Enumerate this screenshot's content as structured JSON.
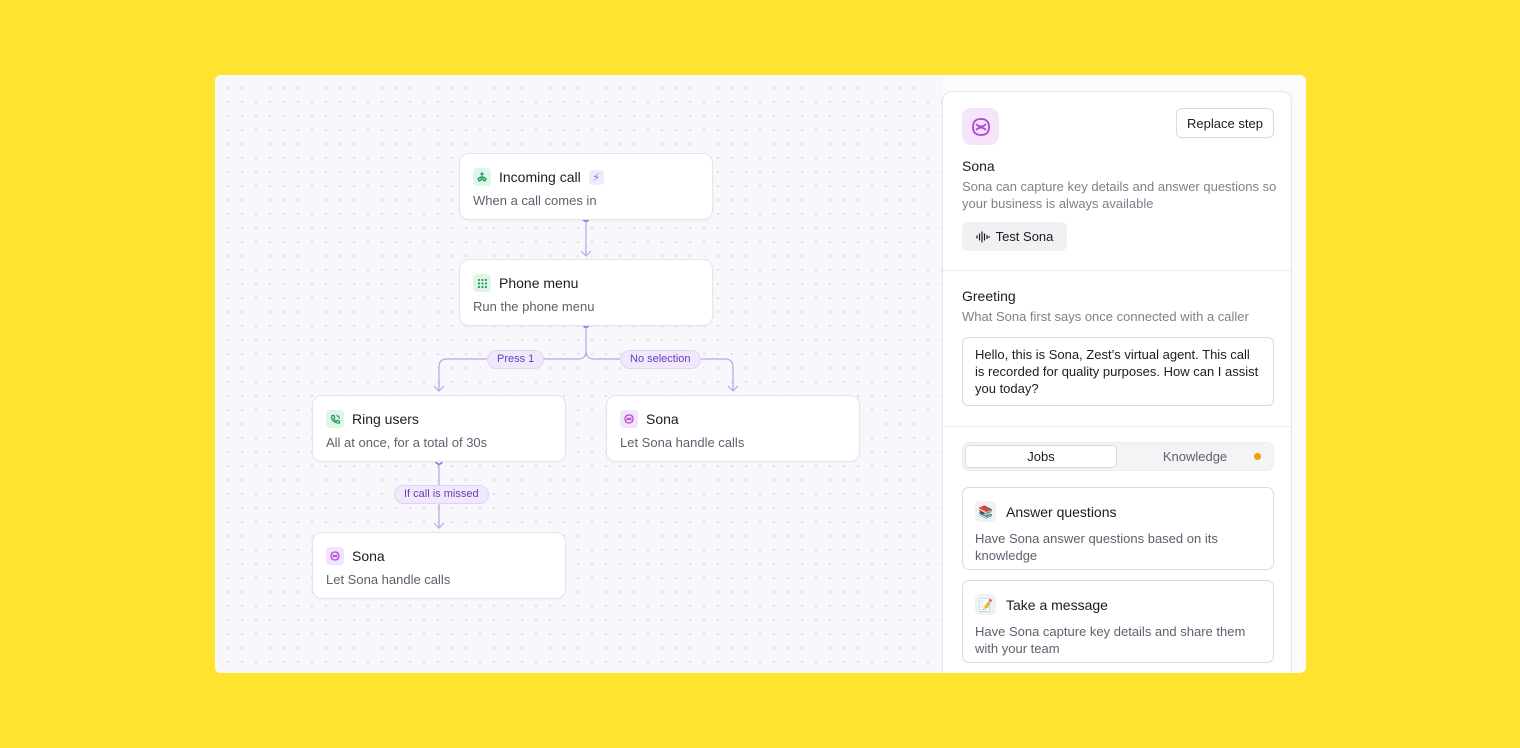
{
  "flow": {
    "nodes": [
      {
        "title": "Incoming call",
        "subtitle": "When a call comes in",
        "icon": "phone-incoming-icon",
        "badge_icon": "bolt-icon"
      },
      {
        "title": "Phone menu",
        "subtitle": "Run the phone menu",
        "icon": "keypad-icon"
      },
      {
        "title": "Ring users",
        "subtitle": "All at once, for a total of 30s",
        "icon": "phone-ring-icon"
      },
      {
        "title": "Sona",
        "subtitle": "Let Sona handle calls",
        "icon": "sona-icon"
      },
      {
        "title": "Sona",
        "subtitle": "Let Sona handle calls",
        "icon": "sona-icon"
      }
    ],
    "edge_labels": {
      "press1": "Press 1",
      "no_selection": "No selection",
      "if_missed": "If call is missed"
    }
  },
  "panel": {
    "replace_step": "Replace step",
    "agent_name": "Sona",
    "agent_desc_line1": "Sona can capture key details and answer questions so",
    "agent_desc_line2": "your business is always available",
    "test_button": "Test Sona",
    "greeting": {
      "title": "Greeting",
      "subtitle": "What Sona first says once connected with a caller",
      "text": "Hello, this is Sona, Zest’s virtual agent. This call is recorded for quality purposes. How can I assist you today?"
    },
    "tabs": {
      "jobs": "Jobs",
      "knowledge": "Knowledge"
    },
    "jobs": [
      {
        "title": "Answer questions",
        "desc": "Have Sona answer questions based on its knowledge",
        "icon": "books-icon"
      },
      {
        "title": "Take a message",
        "desc": "Have Sona capture key details and share them with your team",
        "icon": "memo-icon"
      }
    ]
  },
  "colors": {
    "background": "#FFE32E",
    "accent": "#8b5cf6",
    "notification_dot": "#f59e0b"
  }
}
